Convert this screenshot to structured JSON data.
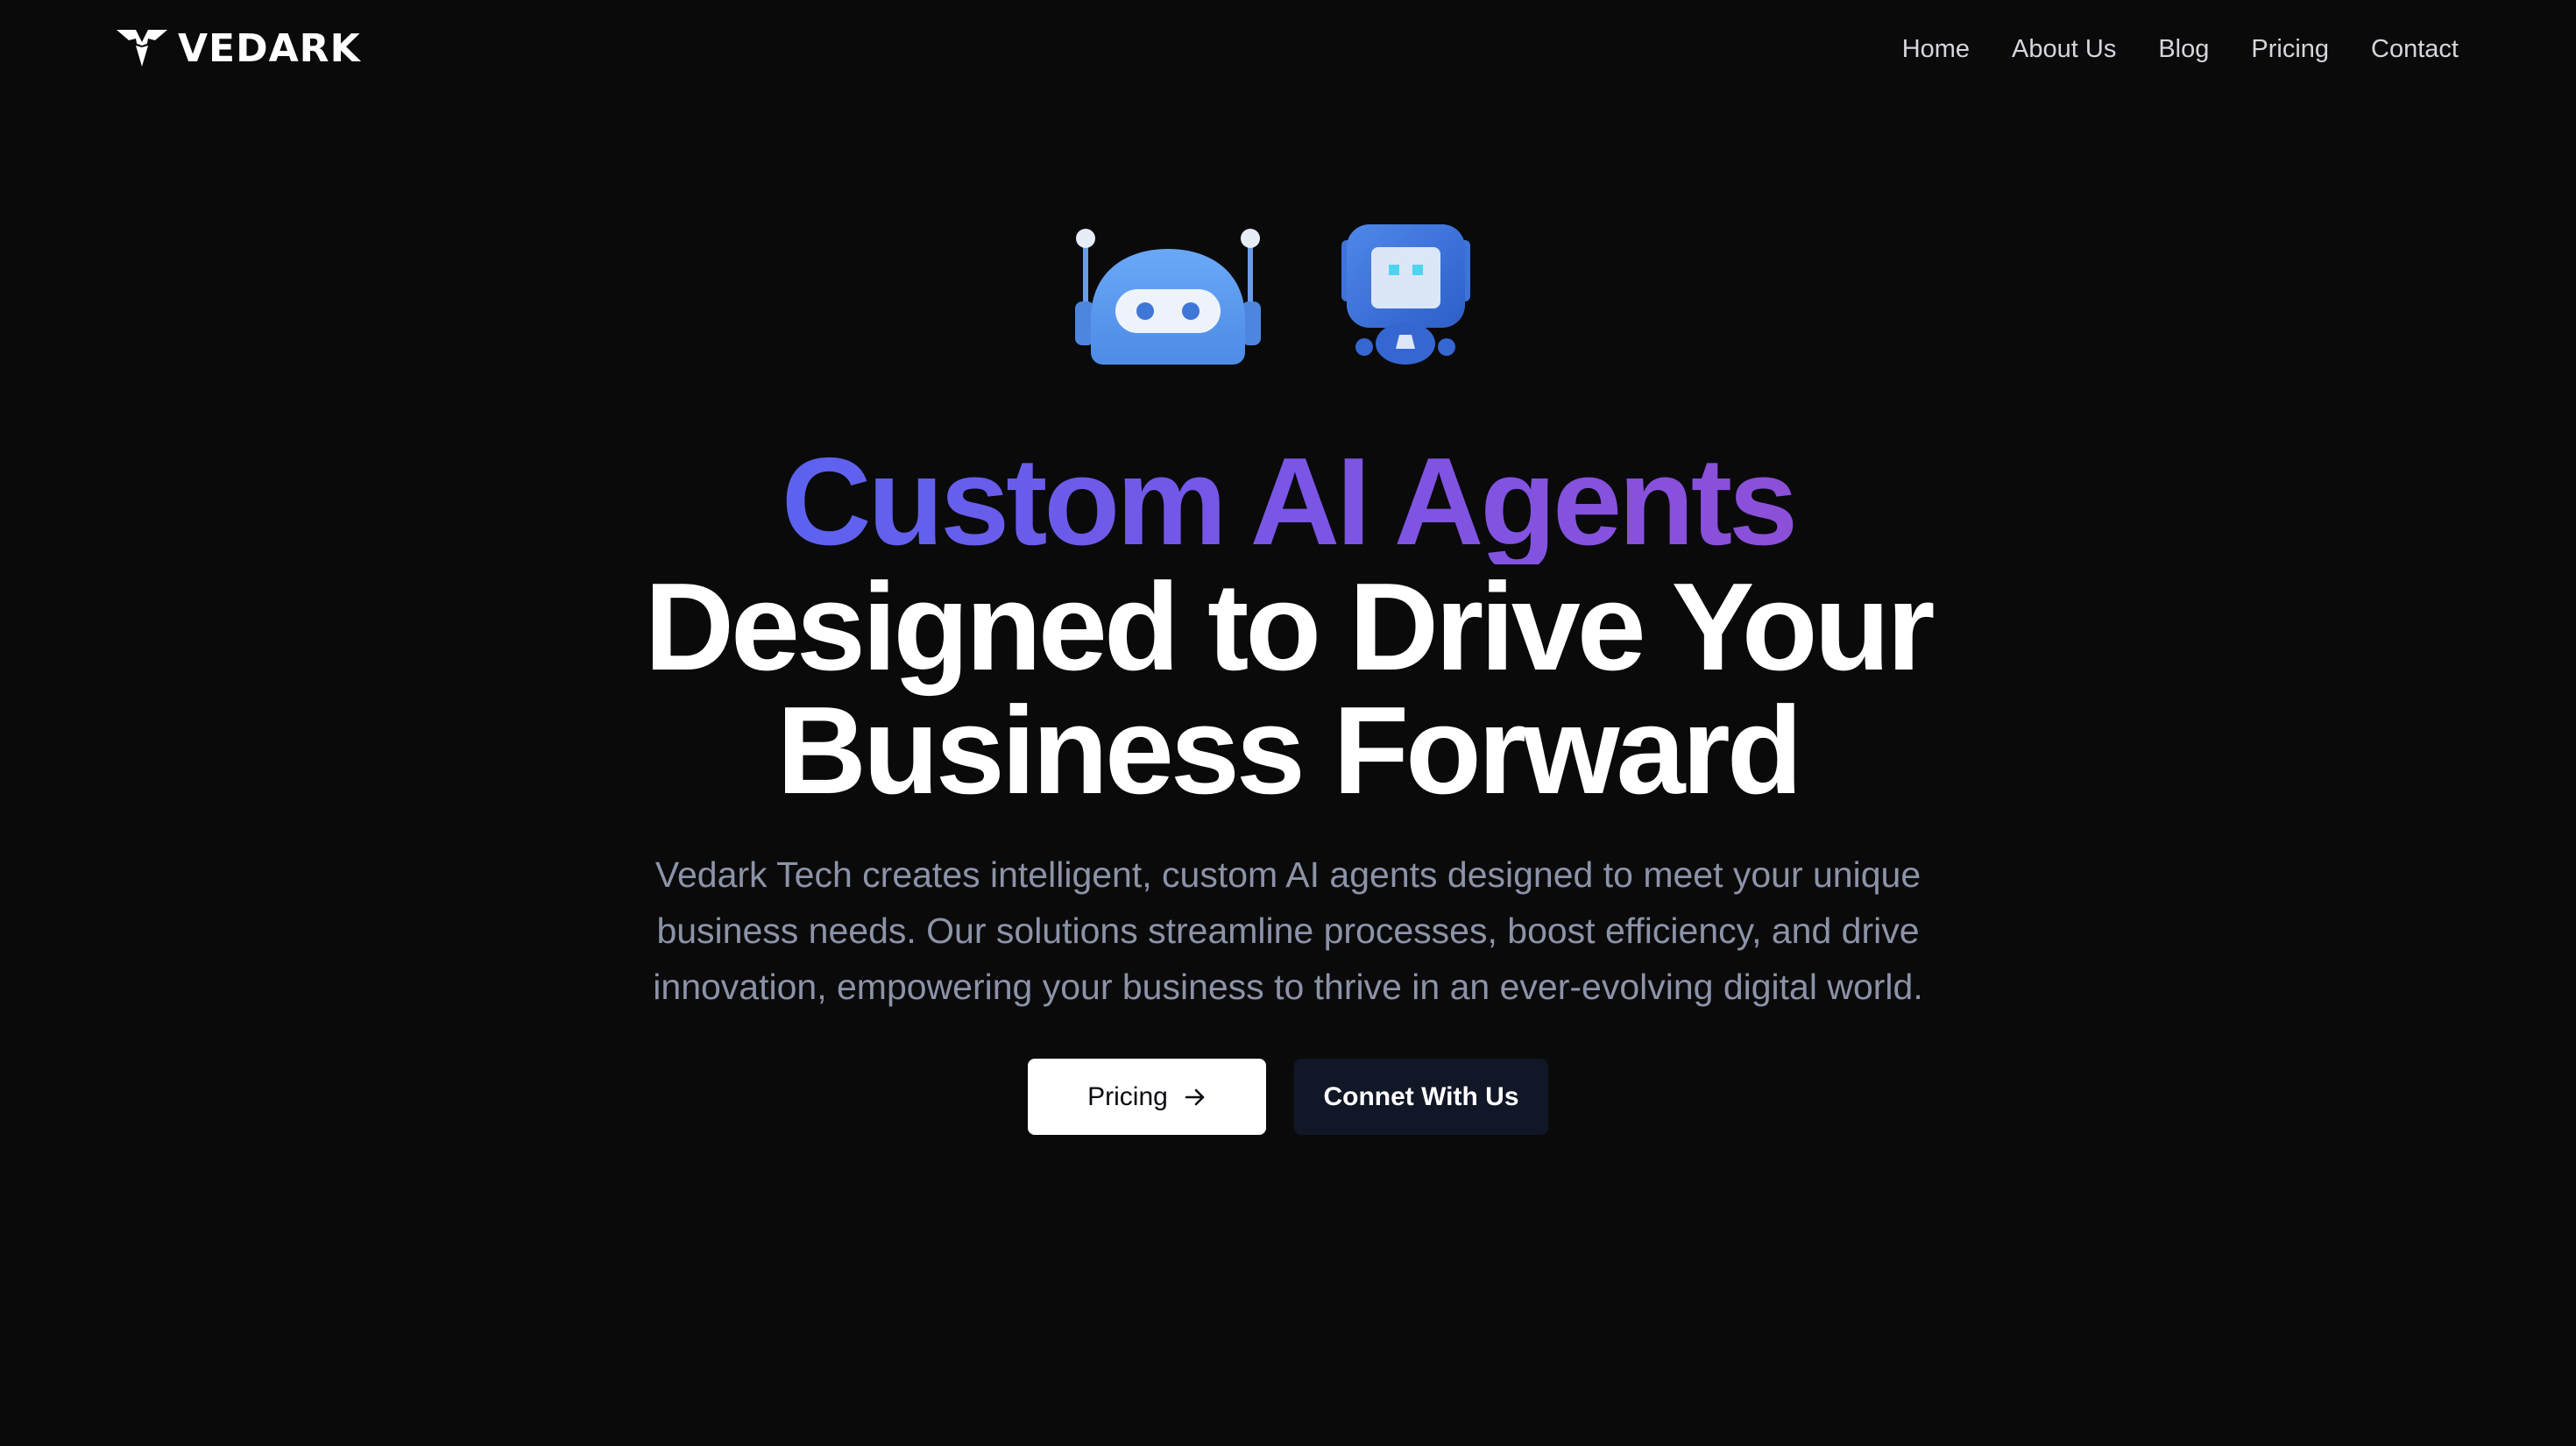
{
  "brand": {
    "name": "VEDARK",
    "logo_icon": "vedark-v-logo-icon",
    "text_color": "#ffffff"
  },
  "nav": {
    "items": [
      {
        "label": "Home"
      },
      {
        "label": "About Us"
      },
      {
        "label": "Blog"
      },
      {
        "label": "Pricing"
      },
      {
        "label": "Contact"
      }
    ]
  },
  "hero": {
    "icons": [
      "antenna-robot-icon",
      "screen-robot-icon"
    ],
    "headline_line1": "Custom AI Agents",
    "headline_line2": "Designed to Drive Your",
    "headline_line3": "Business Forward",
    "description": "Vedark Tech creates intelligent, custom AI agents designed to meet your unique business needs. Our solutions streamline processes, boost efficiency, and drive innovation, empowering your business to thrive in an ever-evolving digital world.",
    "gradient_colors": [
      "#5b63ef",
      "#8d4fd8"
    ]
  },
  "actions": {
    "pricing_label": "Pricing",
    "pricing_icon": "arrow-right-icon",
    "connect_label": "Connet With Us"
  },
  "colors": {
    "background": "#0a0a0b",
    "primary_button": "#ffffff",
    "secondary_button": "#111726",
    "subtext": "#8c93a8"
  }
}
